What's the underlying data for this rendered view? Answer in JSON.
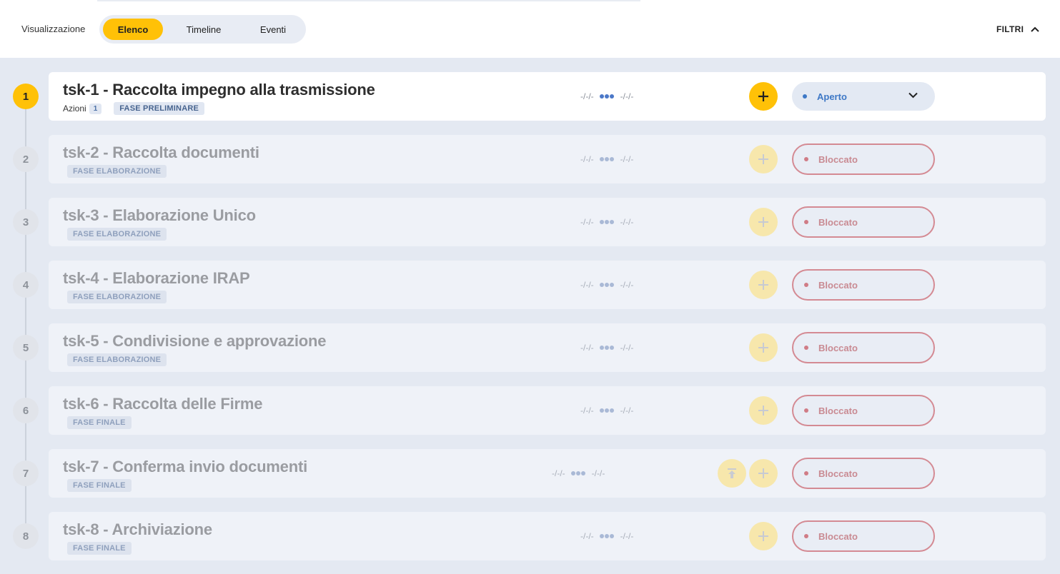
{
  "header": {
    "view_label": "Visualizzazione",
    "views": [
      {
        "label": "Elenco",
        "active": true
      },
      {
        "label": "Timeline",
        "active": false
      },
      {
        "label": "Eventi",
        "active": false
      }
    ],
    "filters_label": "FILTRI"
  },
  "colors": {
    "accent": "#ffc107",
    "open_status": "#3e78c6",
    "blocked_status": "#d07c86"
  },
  "tasks": [
    {
      "step": "1",
      "title": "tsk-1 - Raccolta impegno alla trasmissione",
      "actions_label": "Azioni",
      "actions_count": "1",
      "phase": "FASE PRELIMINARE",
      "date_start": "-/-/-",
      "date_end": "-/-/-",
      "status": "Aperto"
    },
    {
      "step": "2",
      "title": "tsk-2 - Raccolta documenti",
      "phase": "FASE ELABORAZIONE",
      "date_start": "-/-/-",
      "date_end": "-/-/-",
      "status": "Bloccato"
    },
    {
      "step": "3",
      "title": "tsk-3 - Elaborazione Unico",
      "phase": "FASE ELABORAZIONE",
      "date_start": "-/-/-",
      "date_end": "-/-/-",
      "status": "Bloccato"
    },
    {
      "step": "4",
      "title": "tsk-4 - Elaborazione IRAP",
      "phase": "FASE ELABORAZIONE",
      "date_start": "-/-/-",
      "date_end": "-/-/-",
      "status": "Bloccato"
    },
    {
      "step": "5",
      "title": "tsk-5 - Condivisione e approvazione",
      "phase": "FASE ELABORAZIONE",
      "date_start": "-/-/-",
      "date_end": "-/-/-",
      "status": "Bloccato"
    },
    {
      "step": "6",
      "title": "tsk-6 - Raccolta delle Firme",
      "phase": "FASE FINALE",
      "date_start": "-/-/-",
      "date_end": "-/-/-",
      "status": "Bloccato"
    },
    {
      "step": "7",
      "title": "tsk-7 - Conferma invio documenti",
      "phase": "FASE FINALE",
      "date_start": "-/-/-",
      "date_end": "-/-/-",
      "status": "Bloccato",
      "upload_icon": "upload-icon"
    },
    {
      "step": "8",
      "title": "tsk-8 - Archiviazione",
      "phase": "FASE FINALE",
      "date_start": "-/-/-",
      "date_end": "-/-/-",
      "status": "Bloccato"
    }
  ]
}
